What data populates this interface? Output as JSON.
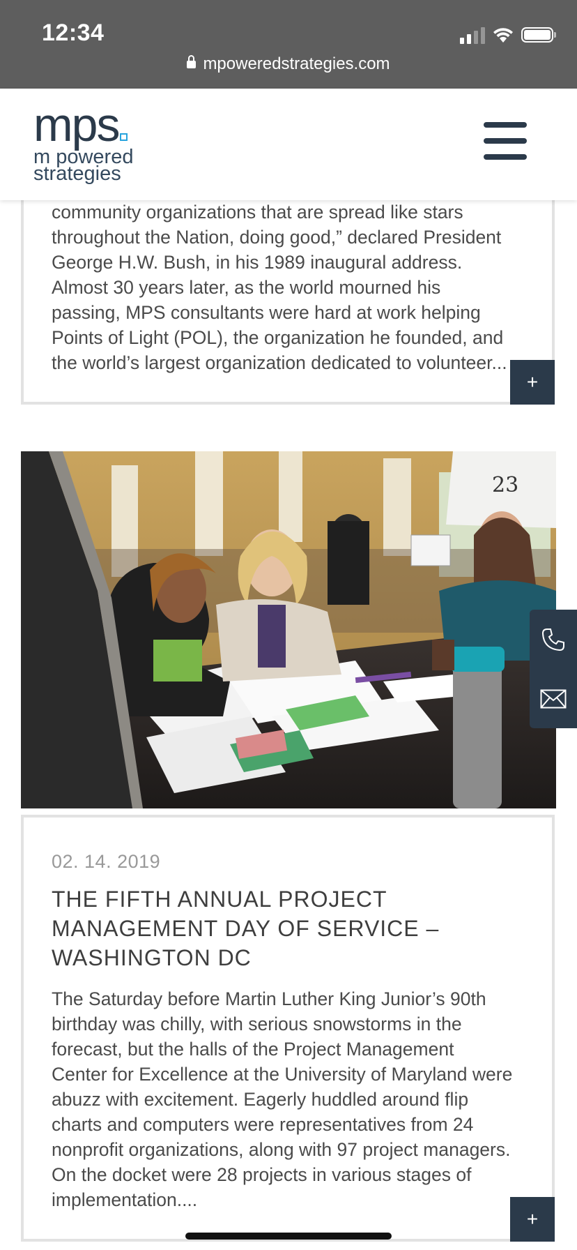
{
  "status_bar": {
    "time": "12:34",
    "url": "mpoweredstrategies.com"
  },
  "header": {
    "logo_mark": "mps",
    "logo_line1": "m powered",
    "logo_line2": "strategies",
    "menu_icon": "hamburger-menu-icon",
    "accent_color": "#27a3dd",
    "brand_color": "#2b3a4a"
  },
  "posts": [
    {
      "excerpt": "community organizations that are spread like stars throughout the Nation, doing good,”  declared President George H.W. Bush, in his 1989 inaugural address. Almost 30 years later, as the world mourned his passing, MPS consultants were hard at work helping Points of Light (POL),  the organization he founded, and the world’s largest organization dedicated to volunteer...",
      "more_label": "+"
    },
    {
      "photo_label": "23",
      "date": "02. 14. 2019",
      "title": "THE FIFTH ANNUAL PROJECT MANAGEMENT DAY OF SERVICE – WASHINGTON DC",
      "excerpt": "The Saturday before Martin Luther King Junior’s 90th birthday was chilly, with serious snowstorms in the forecast, but the halls of the Project Management Center for Excellence at the University of Maryland were abuzz with excitement. Eagerly huddled around flip charts and computers were representatives from 24 nonprofit organizations, along with 97 project managers. On the docket were 28 projects in various stages of implementation....",
      "more_label": "+"
    }
  ],
  "contact_rail": {
    "phone_icon": "phone-icon",
    "mail_icon": "mail-icon"
  }
}
